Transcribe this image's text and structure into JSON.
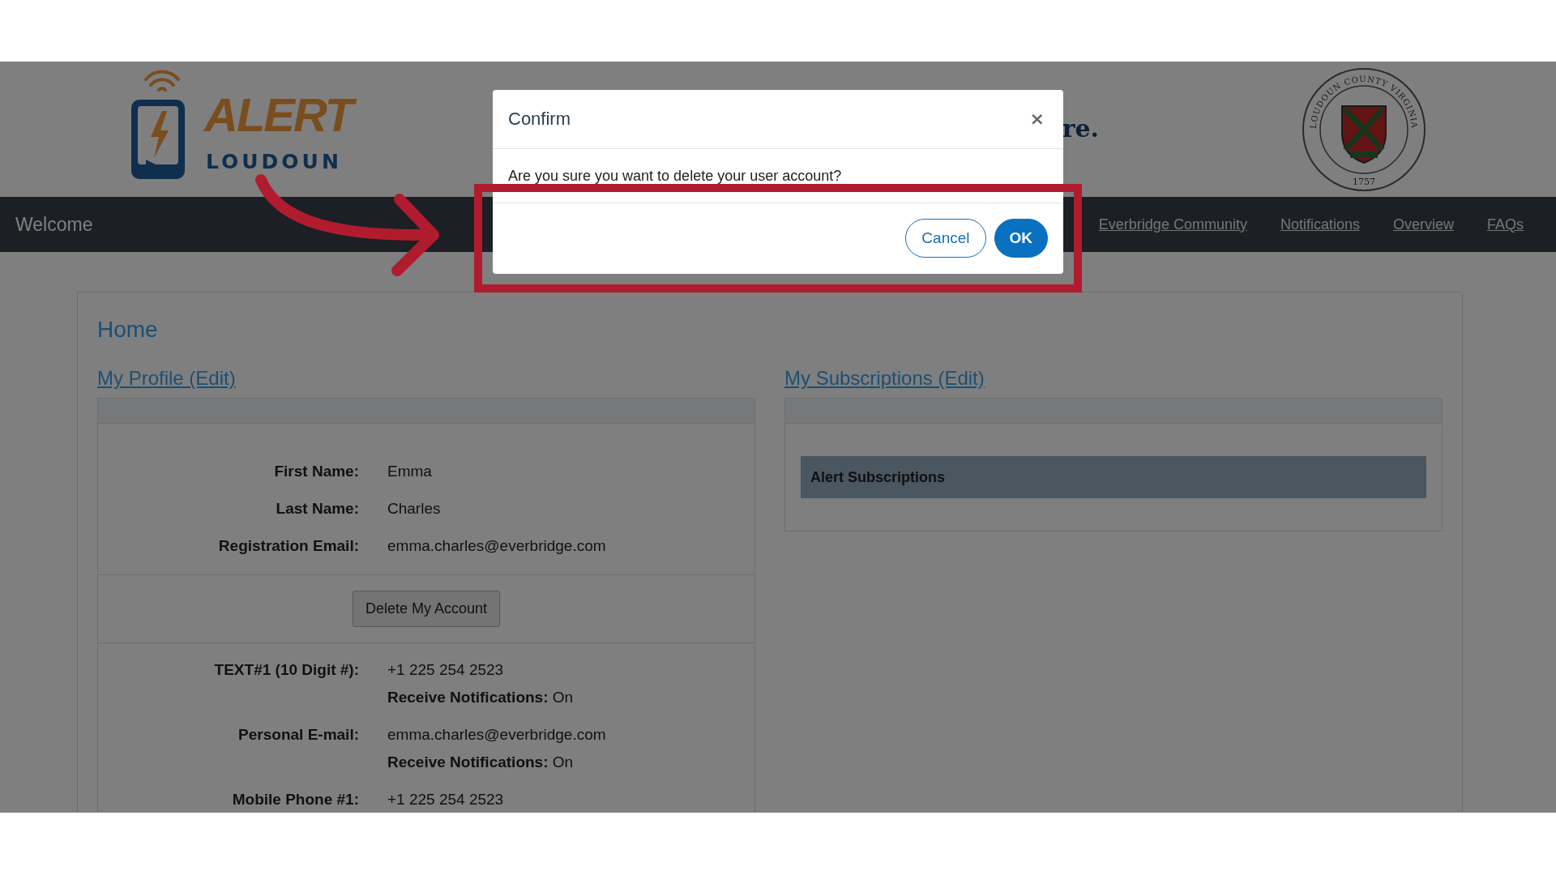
{
  "header": {
    "logo": {
      "word_1": "ALERT",
      "word_2": "LOUDOUN"
    },
    "tagline_fragment": "re.",
    "seal": {
      "ring_text": "LOUDOUN COUNTY VIRGINIA",
      "year": "1757"
    }
  },
  "nav": {
    "brand": "Welcome",
    "links": [
      "Everbridge Community",
      "Notifications",
      "Overview",
      "FAQs"
    ]
  },
  "main": {
    "title": "Home",
    "profile": {
      "heading": "My Profile (Edit)",
      "fields": [
        {
          "label": "First Name:",
          "value": "Emma"
        },
        {
          "label": "Last Name:",
          "value": "Charles"
        },
        {
          "label": "Registration Email:",
          "value": "emma.charles@everbridge.com"
        }
      ],
      "delete_button": "Delete My Account",
      "contacts": [
        {
          "label": "TEXT#1 (10 Digit #):",
          "value": "+1 225 254 2523",
          "note": "**Receive Notifications:** On"
        },
        {
          "label": "Personal E-mail:",
          "value": "emma.charles@everbridge.com",
          "note": "**Receive Notifications:** On"
        },
        {
          "label": "Mobile Phone #1:",
          "value": "+1 225 254 2523"
        }
      ]
    },
    "subscriptions": {
      "heading": "My Subscriptions (Edit)",
      "bar": "Alert Subscriptions"
    }
  },
  "dialog": {
    "title": "Confirm",
    "close": "×",
    "message": "Are you sure you want to delete your user account?",
    "buttons": [
      {
        "label": "Cancel",
        "kind": "secondary"
      },
      {
        "label": "OK",
        "kind": "primary"
      }
    ]
  }
}
